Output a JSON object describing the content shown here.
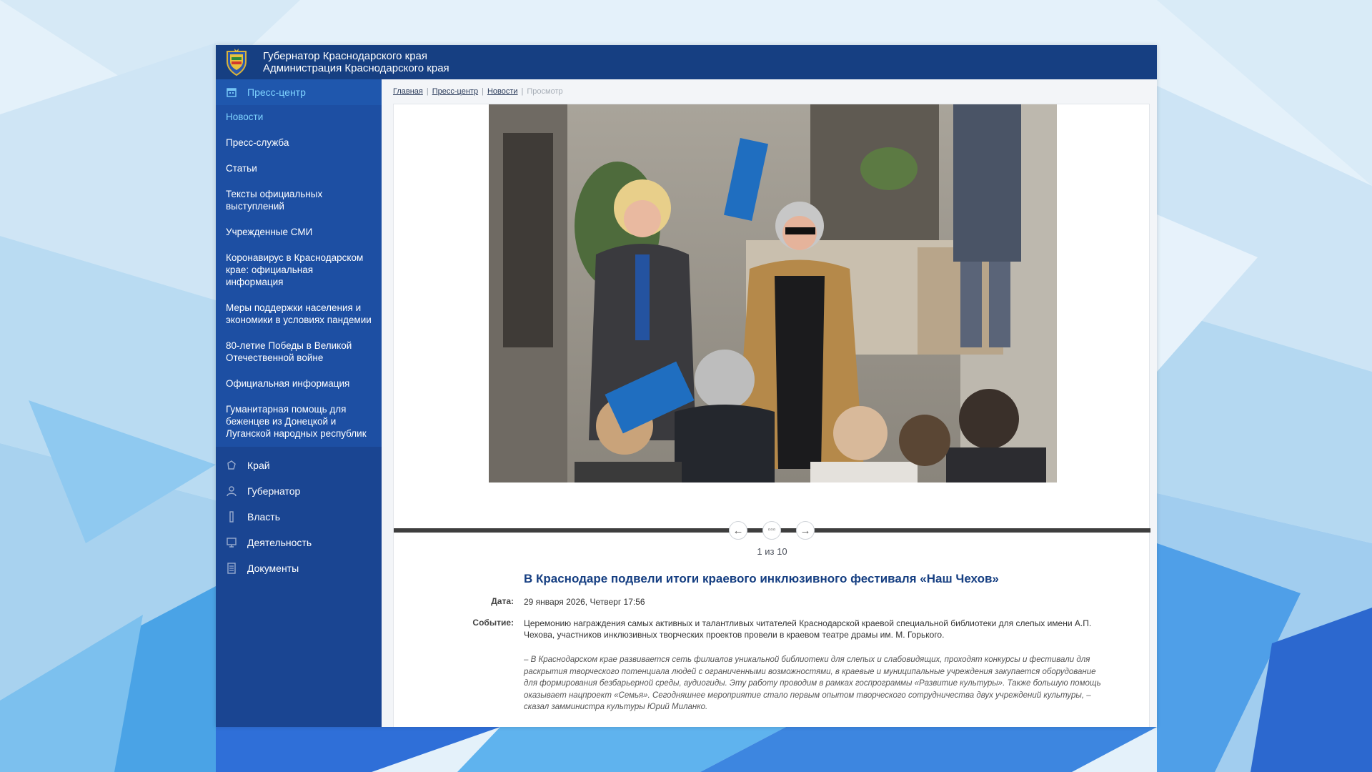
{
  "header": {
    "line1": "Губернатор Краснодарского края",
    "line2": "Администрация Краснодарского края"
  },
  "sidebar": {
    "section_title": "Пресс-центр",
    "submenu": [
      {
        "label": "Новости",
        "active": true
      },
      {
        "label": "Пресс-служба"
      },
      {
        "label": "Статьи"
      },
      {
        "label": "Тексты официальных выступлений"
      },
      {
        "label": "Учрежденные СМИ"
      },
      {
        "label": "Коронавирус в Краснодарском крае: официальная информация"
      },
      {
        "label": "Меры поддержки населения и экономики в условиях пандемии"
      },
      {
        "label": "80-летие Победы в Великой Отечественной войне"
      },
      {
        "label": "Официальная информация"
      },
      {
        "label": "Гуманитарная помощь для беженцев из Донецкой и Луганской народных республик"
      }
    ],
    "nav": [
      {
        "label": "Край",
        "icon": "region-icon"
      },
      {
        "label": "Губернатор",
        "icon": "person-icon"
      },
      {
        "label": "Власть",
        "icon": "column-icon"
      },
      {
        "label": "Деятельность",
        "icon": "monitor-icon"
      },
      {
        "label": "Документы",
        "icon": "document-icon"
      }
    ]
  },
  "breadcrumb": {
    "items": [
      "Главная",
      "Пресс-центр",
      "Новости"
    ],
    "current": "Просмотр"
  },
  "gallery": {
    "counter": "1 из 10",
    "prev_icon": "←",
    "grid_icon": "▫▫▫",
    "next_icon": "→"
  },
  "article": {
    "title": "В Краснодаре подвели итоги краевого инклюзивного фестиваля «Наш Чехов»",
    "date_label": "Дата:",
    "date_value": "29 января 2026, Четверг 17:56",
    "event_label": "Событие:",
    "event_value": "Церемонию награждения самых активных и талантливых читателей Краснодарской краевой специальной библиотеки для слепых имени А.П. Чехова, участников инклюзивных творческих проектов провели в краевом театре драмы им. М. Горького.",
    "quote": "– В Краснодарском крае развивается сеть филиалов уникальной библиотеки для слепых и слабовидящих, проходят конкурсы и фестивали для раскрытия творческого потенциала людей с ограниченными возможностями, в краевые и муниципальные учреждения закупается оборудование для формирования безбарьерной среды, аудиогиды. Эту работу проводим в рамках госпрограммы «Развитие культуры». Также большую помощь оказывает нацпроект «Семья». Сегодняшнее мероприятие стало первым опытом творческого сотрудничества двух учреждений культуры, – сказал замминистра культуры Юрий Миланко."
  },
  "colors": {
    "header_bg": "#163f82",
    "sidebar_bg": "#1a4592",
    "active_link": "#7fd3ff",
    "title": "#163f82"
  }
}
